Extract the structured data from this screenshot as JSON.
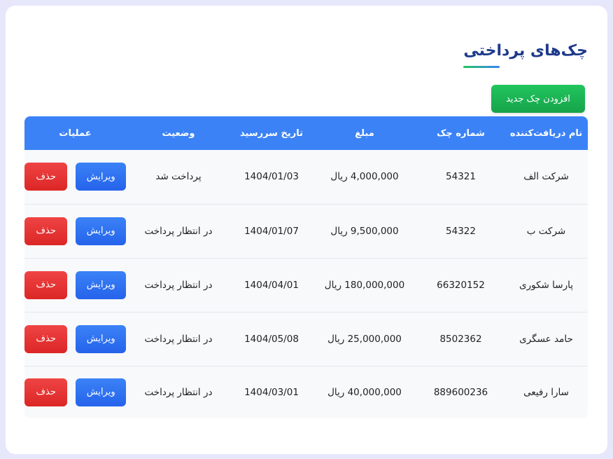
{
  "page": {
    "title": "چک‌های پرداختی",
    "add_button": "افزودن چک جدید"
  },
  "table": {
    "headers": {
      "recipient": "نام دریافت‌کننده",
      "check_number": "شماره چک",
      "amount": "مبلغ",
      "due_date": "تاریخ سررسید",
      "status": "وضعیت",
      "operations": "عملیات"
    },
    "rows": [
      {
        "recipient": "شرکت الف",
        "check_number": "54321",
        "amount": "4,000,000 ریال",
        "due_date": "1404/01/03",
        "status": "پرداخت شد",
        "edit": "ویرایش",
        "delete": "حذف"
      },
      {
        "recipient": "شرکت ب",
        "check_number": "54322",
        "amount": "9,500,000 ریال",
        "due_date": "1404/01/07",
        "status": "در انتظار پرداخت",
        "edit": "ویرایش",
        "delete": "حذف"
      },
      {
        "recipient": "پارسا شکوری",
        "check_number": "66320152",
        "amount": "180,000,000 ریال",
        "due_date": "1404/04/01",
        "status": "در انتظار پرداخت",
        "edit": "ویرایش",
        "delete": "حذف"
      },
      {
        "recipient": "حامد عسگری",
        "check_number": "8502362",
        "amount": "25,000,000 ریال",
        "due_date": "1404/05/08",
        "status": "در انتظار پرداخت",
        "edit": "ویرایش",
        "delete": "حذف"
      },
      {
        "recipient": "سارا رفیعی",
        "check_number": "889600236",
        "amount": "40,000,000 ریال",
        "due_date": "1404/03/01",
        "status": "در انتظار پرداخت",
        "edit": "ویرایش",
        "delete": "حذف"
      }
    ]
  },
  "colors": {
    "background": "#e6e7fb",
    "title": "#1e3a8a",
    "header": "#3b82f6",
    "add_button": "#22c55e",
    "edit_button": "#3b82f6",
    "delete_button": "#ef4444"
  }
}
